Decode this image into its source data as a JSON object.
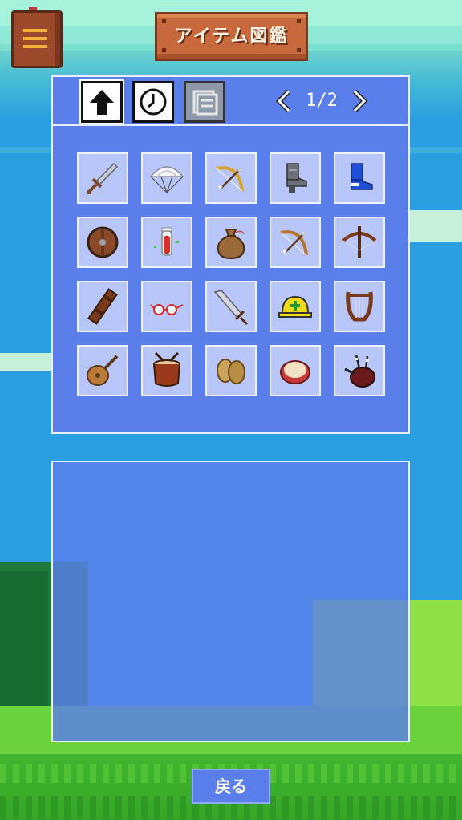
{
  "header": {
    "title": "アイテム図鑑",
    "menu_icon": "book-menu-icon"
  },
  "toolbar": {
    "sort_buttons": [
      {
        "name": "sort-up-arrow-icon",
        "state": "active"
      },
      {
        "name": "clock-icon",
        "state": "active"
      },
      {
        "name": "stack-icon",
        "state": "disabled"
      }
    ],
    "page_indicator": "1/2"
  },
  "items": [
    {
      "icon": "sword-icon"
    },
    {
      "icon": "parachute-icon"
    },
    {
      "icon": "golden-bow-icon"
    },
    {
      "icon": "iron-boot-icon"
    },
    {
      "icon": "blue-boot-icon"
    },
    {
      "icon": "round-shield-icon"
    },
    {
      "icon": "red-potion-icon"
    },
    {
      "icon": "pouch-icon"
    },
    {
      "icon": "bow-icon"
    },
    {
      "icon": "crossbow-icon"
    },
    {
      "icon": "quiver-icon"
    },
    {
      "icon": "glasses-icon"
    },
    {
      "icon": "greatsword-icon"
    },
    {
      "icon": "hard-hat-icon"
    },
    {
      "icon": "lyre-icon"
    },
    {
      "icon": "lute-icon"
    },
    {
      "icon": "drum-icon"
    },
    {
      "icon": "cymbals-icon"
    },
    {
      "icon": "tambourine-icon"
    },
    {
      "icon": "bagpipe-icon"
    }
  ],
  "description": "",
  "footer": {
    "back_label": "戻る"
  },
  "colors": {
    "panel": "#5a7fea",
    "slot": "#b8c6fa",
    "sign": "#c7693c"
  }
}
